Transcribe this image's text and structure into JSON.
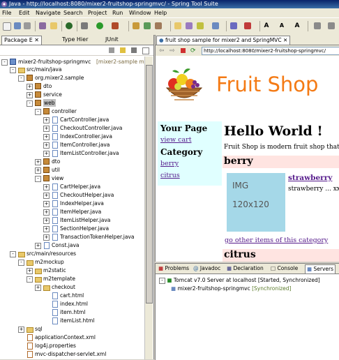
{
  "window": {
    "title": "Java - http://localhost:8080/mixer2-fruitshop-springmvc/ - Spring Tool Suite"
  },
  "menu": [
    "File",
    "Edit",
    "Navigate",
    "Search",
    "Project",
    "Run",
    "Window",
    "Help"
  ],
  "left_panel": {
    "tabs": [
      "Package E",
      "Type Hier",
      "JUnit"
    ],
    "tree": [
      {
        "label": "mixer2-fruitshop-springmvc",
        "extra": "[mixer2-sample ma"
      },
      {
        "label": "src/main/java"
      },
      {
        "label": "org.mixer2.sample"
      },
      {
        "label": "dto"
      },
      {
        "label": "service"
      },
      {
        "label": "web"
      },
      {
        "label": "controller"
      },
      {
        "label": "CartController.java"
      },
      {
        "label": "CheckoutController.java"
      },
      {
        "label": "IndexController.java"
      },
      {
        "label": "ItemController.java"
      },
      {
        "label": "ItemListController.java"
      },
      {
        "label": "dto"
      },
      {
        "label": "util"
      },
      {
        "label": "view"
      },
      {
        "label": "CartHelper.java"
      },
      {
        "label": "CheckoutHelper.java"
      },
      {
        "label": "IndexHelper.java"
      },
      {
        "label": "ItemHelper.java"
      },
      {
        "label": "ItemListHelper.java"
      },
      {
        "label": "SectionHelper.java"
      },
      {
        "label": "TransactionTokenHelper.java"
      },
      {
        "label": "Const.java"
      },
      {
        "label": "src/main/resources"
      },
      {
        "label": "m2mockup"
      },
      {
        "label": "m2static"
      },
      {
        "label": "m2template"
      },
      {
        "label": "checkout"
      },
      {
        "label": "cart.html"
      },
      {
        "label": "index.html"
      },
      {
        "label": "item.html"
      },
      {
        "label": "itemList.html"
      },
      {
        "label": "sql"
      },
      {
        "label": "applicationContext.xml"
      },
      {
        "label": "log4j.properties"
      },
      {
        "label": "mvc-dispatcher-servlet.xml"
      }
    ]
  },
  "browser": {
    "tab_title": "fruit shop sample for mixer2 and SpringMVC",
    "url": "http://localhost:8080/mixer2-fruitshop-springmvc/",
    "page": {
      "shop_title": "Fruit Shop",
      "sidebar": {
        "your_page": "Your Page",
        "view_cart": "view cart",
        "category": "Category",
        "categories": [
          "berry",
          "citrus"
        ]
      },
      "hello": "Hello World !",
      "description": "Fruit Shop is modern fruit shop that p",
      "section1": "berry",
      "img_line1": "IMG",
      "img_line2": "120x120",
      "item_name": "strawberry",
      "item_desc": "strawberry ... xxx",
      "other_items": "go other items of this category",
      "section2": "citrus"
    }
  },
  "bottom_panel": {
    "tabs": [
      "Problems",
      "Javadoc",
      "Declaration",
      "Console",
      "Servers"
    ],
    "server": "Tomcat v7.0 Server at localhost",
    "server_status": "[Started, Synchronized]",
    "module": "mixer2-fruitshop-springmvc",
    "module_status": "[Synchronized]"
  }
}
